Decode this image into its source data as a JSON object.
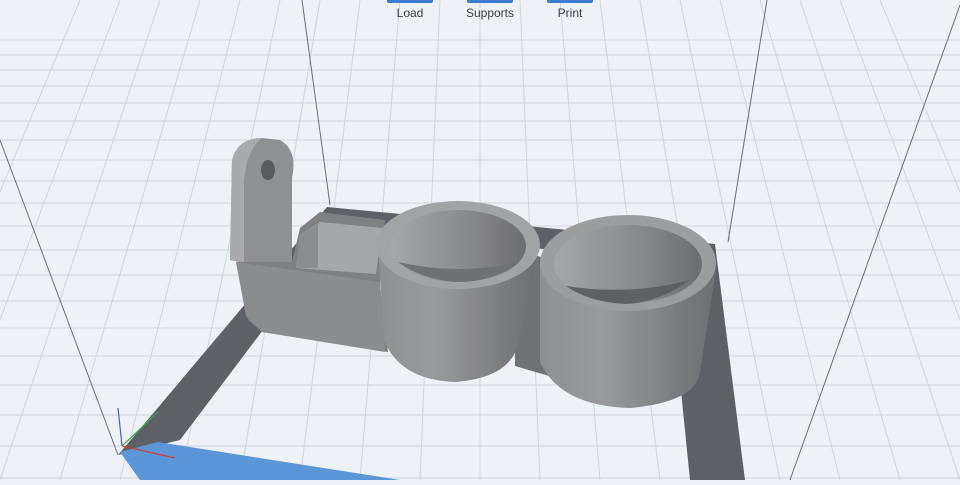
{
  "toolbar": {
    "items": [
      {
        "label": "Load",
        "icon": "load-icon"
      },
      {
        "label": "Supports",
        "icon": "supports-icon"
      },
      {
        "label": "Print",
        "icon": "print-icon"
      }
    ]
  },
  "viewport": {
    "background": "#eef1f5",
    "grid_color": "#cdd6e0",
    "build_plate_border": "#5d6065",
    "model_color": "#8c8d8f",
    "axis_colors": {
      "x": "#d23a3a",
      "y": "#36a843",
      "z": "#4a5fd8"
    },
    "axis_bar": "#5b96d6"
  }
}
